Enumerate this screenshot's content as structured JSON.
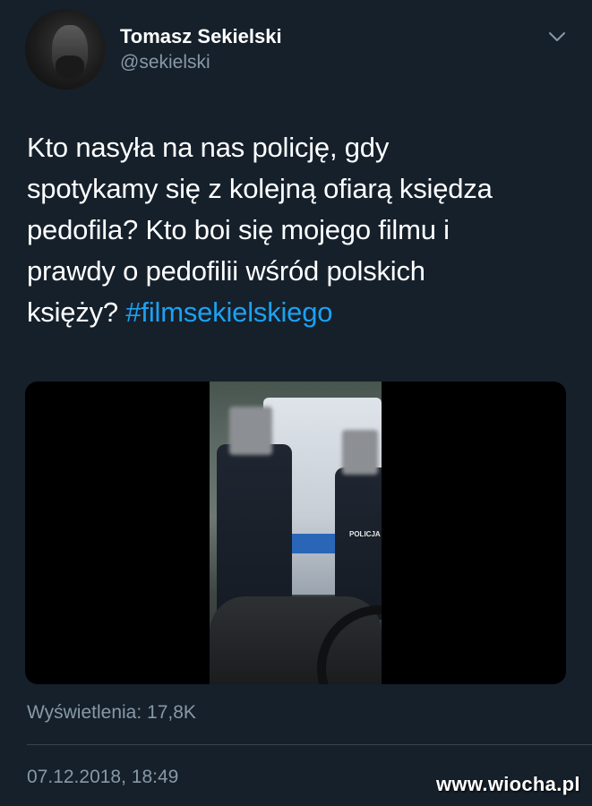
{
  "author": {
    "name": "Tomasz Sekielski",
    "handle": "@sekielski"
  },
  "icons": {
    "menu": "chevron-down-icon",
    "avatar": "avatar"
  },
  "tweet": {
    "lines": [
      "Kto nasyła na nas policję, gdy",
      "spotykamy się z kolejną ofiarą księdza",
      "pedofila? Kto boi się mojego filmu i",
      "prawdy o pedofilii wśród polskich",
      "księży?"
    ],
    "hashtag": "#filmsekielskiego"
  },
  "media": {
    "vest_label": "POLICJA"
  },
  "meta": {
    "views": "Wyświetlenia: 17,8K",
    "timestamp": "07.12.2018, 18:49"
  },
  "watermark": "www.wiocha.pl",
  "colors": {
    "background": "#15202b",
    "text": "#ffffff",
    "secondary": "#8899a6",
    "link": "#1da1f2"
  }
}
